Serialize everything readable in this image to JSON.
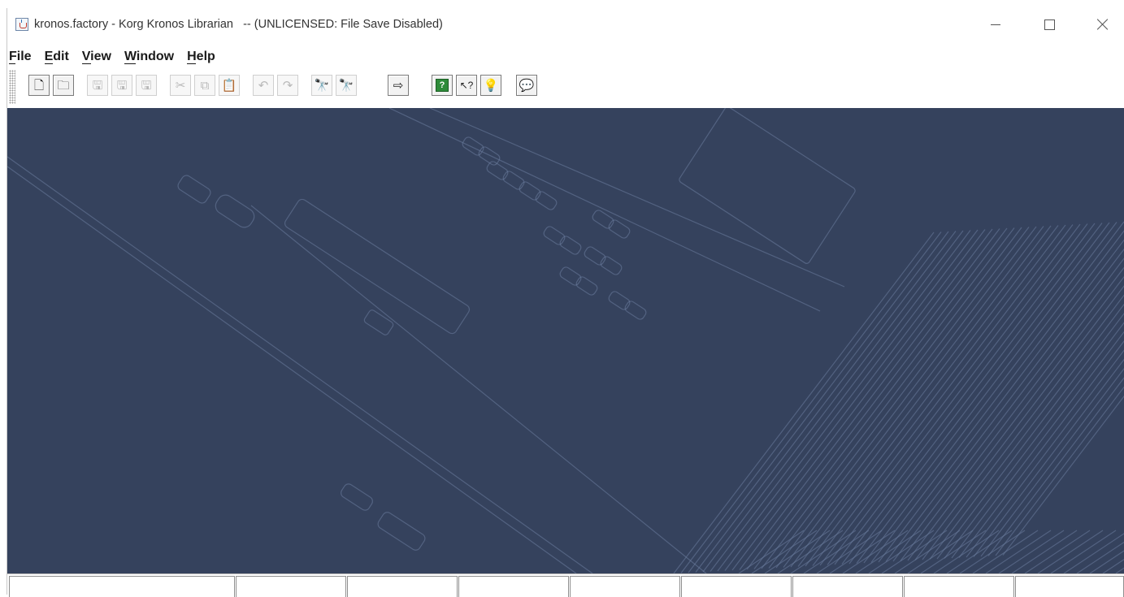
{
  "window": {
    "title": "kronos.factory - Korg Kronos Librarian   -- (UNLICENSED: File Save Disabled)",
    "app_icon": "java-icon"
  },
  "window_controls": {
    "minimize": "minimize-icon",
    "maximize": "maximize-icon",
    "close": "close-icon"
  },
  "menu": {
    "items": [
      {
        "label": "File",
        "mnemonic": "F"
      },
      {
        "label": "Edit",
        "mnemonic": "E"
      },
      {
        "label": "View",
        "mnemonic": "V"
      },
      {
        "label": "Window",
        "mnemonic": "W"
      },
      {
        "label": "Help",
        "mnemonic": "H"
      }
    ]
  },
  "toolbar": {
    "buttons": [
      {
        "icon": "new-file-icon",
        "glyph": "🗋",
        "enabled": true
      },
      {
        "icon": "open-folder-icon",
        "glyph": "🗀",
        "enabled": true
      },
      {
        "icon": "save-icon",
        "glyph": "🖫",
        "enabled": false
      },
      {
        "icon": "save-as-icon",
        "glyph": "🖫",
        "enabled": false
      },
      {
        "icon": "save-all-icon",
        "glyph": "🖫",
        "enabled": false
      },
      {
        "icon": "cut-icon",
        "glyph": "✂",
        "enabled": false
      },
      {
        "icon": "copy-icon",
        "glyph": "⧉",
        "enabled": false
      },
      {
        "icon": "paste-icon",
        "glyph": "📋",
        "enabled": false
      },
      {
        "icon": "undo-icon",
        "glyph": "↶",
        "enabled": false
      },
      {
        "icon": "redo-icon",
        "glyph": "↷",
        "enabled": false
      },
      {
        "icon": "find-icon",
        "glyph": "🔭",
        "enabled": false
      },
      {
        "icon": "find-next-icon",
        "glyph": "🔭",
        "enabled": false
      },
      {
        "icon": "export-icon",
        "glyph": "⇨",
        "enabled": true
      },
      {
        "icon": "help-contents-icon",
        "glyph": "?",
        "enabled": true
      },
      {
        "icon": "context-help-icon",
        "glyph": "↖?",
        "enabled": true
      },
      {
        "icon": "tip-bulb-icon",
        "glyph": "💡",
        "enabled": true
      },
      {
        "icon": "feedback-balloon-icon",
        "glyph": "💬",
        "enabled": true
      }
    ]
  },
  "canvas": {
    "background": "#35425d",
    "line_color": "#6b7e9f"
  },
  "statusbar": {
    "cells": [
      "",
      "",
      "",
      "",
      "",
      "",
      "",
      "",
      "",
      ""
    ]
  }
}
